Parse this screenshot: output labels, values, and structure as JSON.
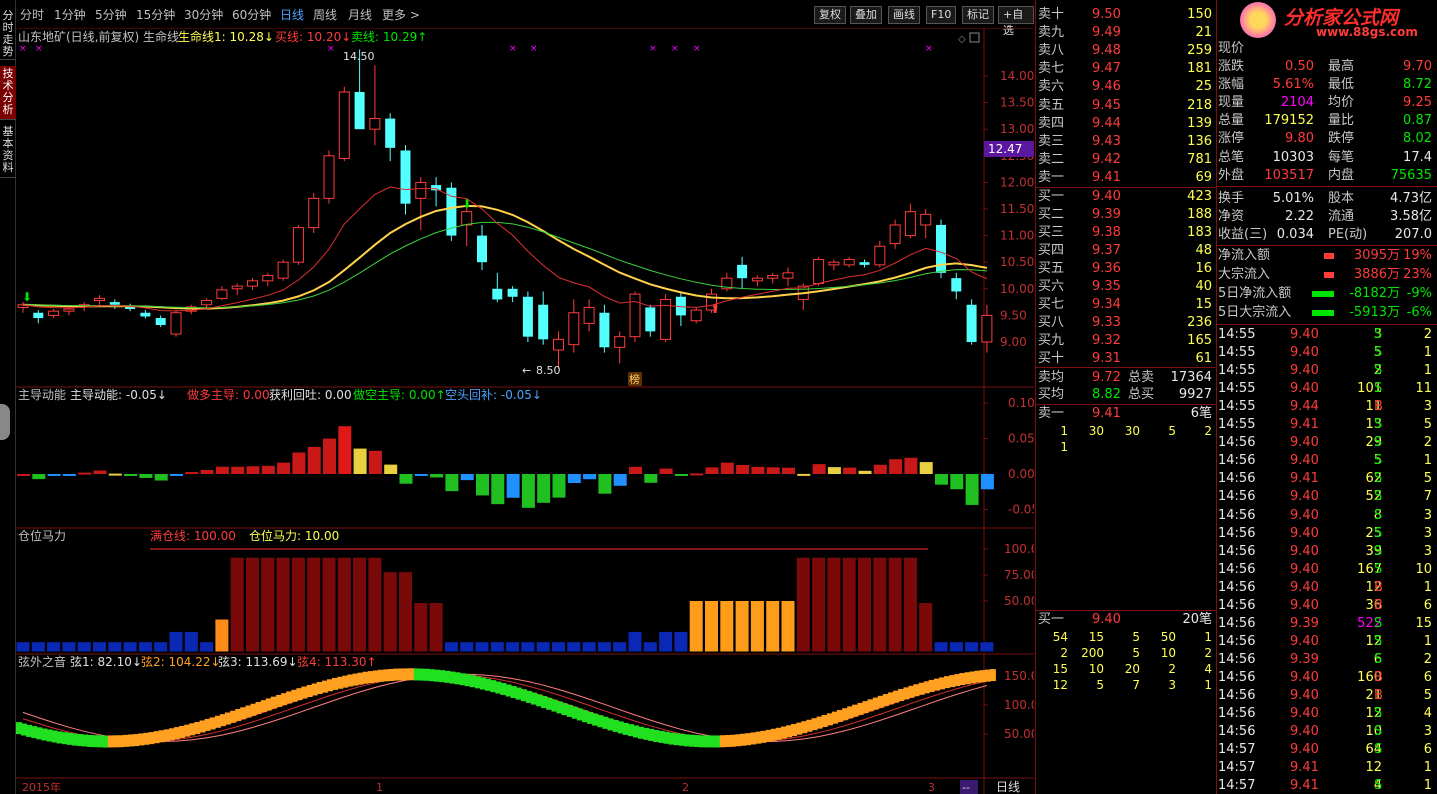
{
  "left_tabs": [
    "分时走势",
    "技术分析",
    "基本资料"
  ],
  "toolbar": {
    "periods": [
      "分时",
      "1分钟",
      "5分钟",
      "15分钟",
      "30分钟",
      "60分钟",
      "日线",
      "周线",
      "月线",
      "更多 >"
    ],
    "active": "日线",
    "buttons": [
      "复权",
      "叠加",
      "画线",
      "F10",
      "标记",
      "+自选"
    ]
  },
  "main_chart": {
    "title": "山东地矿(日线,前复权) 生命线",
    "ind1": "生命线1: 10.28↓",
    "ind2": "买线: 10.20↓",
    "ind3": "卖线: 10.29↑",
    "high_label": "14.50",
    "low_label": "8.50",
    "price_tag": "12.47",
    "bang": "榜",
    "y_ticks": [
      "14.00",
      "13.50",
      "13.00",
      "12.50",
      "12.00",
      "11.50",
      "11.00",
      "10.50",
      "10.00",
      "9.50",
      "9.00"
    ]
  },
  "ind_pane1": {
    "title": "主导动能",
    "v1": "主导动能: -0.05↓",
    "v2": "做多主导: 0.00",
    "v3": "获利回吐: 0.00",
    "v4": "做空主导: 0.00↑",
    "v5": "空头回补: -0.05↓",
    "y_ticks": [
      "0.10",
      "0.05",
      "0.00",
      "-0.05"
    ]
  },
  "ind_pane2": {
    "title": "仓位马力",
    "v1": "满仓线: 100.00",
    "v2": "仓位马力: 10.00",
    "y_ticks": [
      "100.0",
      "75.00",
      "50.00"
    ]
  },
  "ind_pane3": {
    "title": "弦外之音",
    "v1": "弦1: 82.10↓",
    "v2": "弦2: 104.22↓",
    "v3": "弦3: 113.69↓",
    "v4": "弦4: 113.30↑",
    "y_ticks": [
      "150.0",
      "100.0",
      "50.00"
    ]
  },
  "x_axis": {
    "labels": [
      "2015年",
      "1",
      "2",
      "3"
    ],
    "period": "日线",
    "dash": "--"
  },
  "sell_book": [
    {
      "label": "卖十",
      "price": "9.50",
      "vol": "150"
    },
    {
      "label": "卖九",
      "price": "9.49",
      "vol": "21"
    },
    {
      "label": "卖八",
      "price": "9.48",
      "vol": "259"
    },
    {
      "label": "卖七",
      "price": "9.47",
      "vol": "181"
    },
    {
      "label": "卖六",
      "price": "9.46",
      "vol": "25"
    },
    {
      "label": "卖五",
      "price": "9.45",
      "vol": "218"
    },
    {
      "label": "卖四",
      "price": "9.44",
      "vol": "139"
    },
    {
      "label": "卖三",
      "price": "9.43",
      "vol": "136"
    },
    {
      "label": "卖二",
      "price": "9.42",
      "vol": "781"
    },
    {
      "label": "卖一",
      "price": "9.41",
      "vol": "69"
    }
  ],
  "buy_book": [
    {
      "label": "买一",
      "price": "9.40",
      "vol": "423"
    },
    {
      "label": "买二",
      "price": "9.39",
      "vol": "188"
    },
    {
      "label": "买三",
      "price": "9.38",
      "vol": "183"
    },
    {
      "label": "买四",
      "price": "9.37",
      "vol": "48"
    },
    {
      "label": "买五",
      "price": "9.36",
      "vol": "16"
    },
    {
      "label": "买六",
      "price": "9.35",
      "vol": "40"
    },
    {
      "label": "买七",
      "price": "9.34",
      "vol": "15"
    },
    {
      "label": "买八",
      "price": "9.33",
      "vol": "236"
    },
    {
      "label": "买九",
      "price": "9.32",
      "vol": "165"
    },
    {
      "label": "买十",
      "price": "9.31",
      "vol": "61"
    }
  ],
  "avg": {
    "sell_avg_label": "卖均",
    "sell_avg": "9.72",
    "total_sell_label": "总卖",
    "total_sell": "17364",
    "buy_avg_label": "买均",
    "buy_avg": "8.82",
    "total_buy_label": "总买",
    "total_buy": "9927"
  },
  "queue1": {
    "label": "卖一",
    "price": "9.41",
    "count": "6笔",
    "rows": [
      [
        "1",
        "30",
        "30",
        "5",
        "2"
      ],
      [
        "1",
        "",
        "",
        "",
        ""
      ]
    ]
  },
  "queue2": {
    "label": "买一",
    "price": "9.40",
    "count": "20笔",
    "rows": [
      [
        "54",
        "15",
        "5",
        "50",
        "1"
      ],
      [
        "2",
        "200",
        "5",
        "10",
        "2"
      ],
      [
        "15",
        "10",
        "20",
        "2",
        "4"
      ],
      [
        "12",
        "5",
        "7",
        "3",
        "1"
      ]
    ]
  },
  "logo": {
    "text": "分析家公式网",
    "url": "www.88gs.com"
  },
  "quote_head": "现价",
  "quote": [
    {
      "l1": "涨跌",
      "v1": "0.50",
      "c1": "red",
      "l2": "最高",
      "v2": "9.70",
      "c2": "red"
    },
    {
      "l1": "涨幅",
      "v1": "5.61%",
      "c1": "red",
      "l2": "最低",
      "v2": "8.72",
      "c2": "grn"
    },
    {
      "l1": "现量",
      "v1": "2104",
      "c1": "mag",
      "l2": "均价",
      "v2": "9.25",
      "c2": "red"
    },
    {
      "l1": "总量",
      "v1": "179152",
      "c1": "yel",
      "l2": "量比",
      "v2": "0.87",
      "c2": "grn"
    },
    {
      "l1": "涨停",
      "v1": "9.80",
      "c1": "red",
      "l2": "跌停",
      "v2": "8.02",
      "c2": "grn"
    },
    {
      "l1": "总笔",
      "v1": "10303",
      "c1": "wht",
      "l2": "每笔",
      "v2": "17.4",
      "c2": "wht"
    },
    {
      "l1": "外盘",
      "v1": "103517",
      "c1": "red",
      "l2": "内盘",
      "v2": "75635",
      "c2": "grn"
    }
  ],
  "fin": [
    {
      "l1": "换手",
      "v1": "5.01%",
      "l2": "股本",
      "v2": "4.73亿"
    },
    {
      "l1": "净资",
      "v1": "2.22",
      "l2": "流通",
      "v2": "3.58亿"
    },
    {
      "l1": "收益(三)",
      "v1": "0.034",
      "l2": "PE(动)",
      "v2": "207.0"
    }
  ],
  "flow": [
    {
      "label": "净流入额",
      "value": "3095万",
      "pct": "19%",
      "color": "red"
    },
    {
      "label": "大宗流入",
      "value": "3886万",
      "pct": "23%",
      "color": "red"
    },
    {
      "label": "5日净流入额",
      "value": "-8182万",
      "pct": "-9%",
      "color": "grn"
    },
    {
      "label": "5日大宗流入",
      "value": "-5913万",
      "pct": "-6%",
      "color": "grn"
    }
  ],
  "ticks": [
    [
      "14:55",
      "9.40",
      "3",
      "S",
      "2"
    ],
    [
      "14:55",
      "9.40",
      "5",
      "S",
      "1"
    ],
    [
      "14:55",
      "9.40",
      "2",
      "S",
      "1"
    ],
    [
      "14:55",
      "9.40",
      "101",
      "S",
      "11"
    ],
    [
      "14:55",
      "9.44",
      "11",
      "B",
      "3"
    ],
    [
      "14:55",
      "9.41",
      "13",
      "S",
      "5"
    ],
    [
      "14:56",
      "9.40",
      "29",
      "S",
      "2"
    ],
    [
      "14:56",
      "9.40",
      "5",
      "S",
      "1"
    ],
    [
      "14:56",
      "9.41",
      "62",
      "S",
      "5"
    ],
    [
      "14:56",
      "9.40",
      "52",
      "S",
      "7"
    ],
    [
      "14:56",
      "9.40",
      "8",
      "S",
      "3"
    ],
    [
      "14:56",
      "9.40",
      "25",
      "S",
      "3"
    ],
    [
      "14:56",
      "9.40",
      "39",
      "S",
      "3"
    ],
    [
      "14:56",
      "9.40",
      "167",
      "S",
      "10"
    ],
    [
      "14:56",
      "9.40",
      "12",
      "B",
      "1"
    ],
    [
      "14:56",
      "9.40",
      "36",
      "B",
      "6"
    ],
    [
      "14:56",
      "9.39",
      "522",
      "S",
      "15"
    ],
    [
      "14:56",
      "9.40",
      "12",
      "S",
      "1"
    ],
    [
      "14:56",
      "9.39",
      "6",
      "S",
      "2"
    ],
    [
      "14:56",
      "9.40",
      "160",
      "B",
      "6"
    ],
    [
      "14:56",
      "9.40",
      "21",
      "B",
      "5"
    ],
    [
      "14:56",
      "9.40",
      "12",
      "S",
      "4"
    ],
    [
      "14:56",
      "9.40",
      "10",
      "S",
      "3"
    ],
    [
      "14:57",
      "9.40",
      "64",
      "S",
      "6"
    ],
    [
      "14:57",
      "9.41",
      "12",
      "",
      "1"
    ],
    [
      "14:57",
      "9.41",
      "4",
      "S",
      "1"
    ]
  ],
  "colors": {
    "up": "#ff3c3c",
    "down": "#54ffff",
    "bg": "#000000",
    "grid": "#7a1010"
  },
  "chart_data": {
    "type": "candlestick",
    "ylim": [
      8.5,
      14.5
    ],
    "candles": [
      [
        9.65,
        9.75,
        9.55,
        9.7
      ],
      [
        9.55,
        9.6,
        9.35,
        9.45
      ],
      [
        9.5,
        9.62,
        9.45,
        9.58
      ],
      [
        9.58,
        9.65,
        9.5,
        9.62
      ],
      [
        9.66,
        9.75,
        9.58,
        9.7
      ],
      [
        9.78,
        9.88,
        9.7,
        9.82
      ],
      [
        9.75,
        9.8,
        9.62,
        9.7
      ],
      [
        9.66,
        9.72,
        9.58,
        9.62
      ],
      [
        9.55,
        9.6,
        9.44,
        9.48
      ],
      [
        9.45,
        9.5,
        9.28,
        9.32
      ],
      [
        9.15,
        9.6,
        9.1,
        9.55
      ],
      [
        9.58,
        9.7,
        9.52,
        9.66
      ],
      [
        9.7,
        9.82,
        9.62,
        9.78
      ],
      [
        9.82,
        10.05,
        9.78,
        9.98
      ],
      [
        10.0,
        10.1,
        9.88,
        10.05
      ],
      [
        10.05,
        10.2,
        9.98,
        10.15
      ],
      [
        10.15,
        10.3,
        10.05,
        10.25
      ],
      [
        10.2,
        10.55,
        10.15,
        10.5
      ],
      [
        10.5,
        11.2,
        10.45,
        11.15
      ],
      [
        11.15,
        11.8,
        11.05,
        11.7
      ],
      [
        11.7,
        12.6,
        11.6,
        12.5
      ],
      [
        12.45,
        13.8,
        12.4,
        13.7
      ],
      [
        13.7,
        14.5,
        13.5,
        13.0
      ],
      [
        13.0,
        14.2,
        12.7,
        13.2
      ],
      [
        13.2,
        13.3,
        12.4,
        12.65
      ],
      [
        12.6,
        12.7,
        11.4,
        11.6
      ],
      [
        11.7,
        12.1,
        11.1,
        12.0
      ],
      [
        11.95,
        12.1,
        11.55,
        11.85
      ],
      [
        11.9,
        12.0,
        10.9,
        11.0
      ],
      [
        11.2,
        11.6,
        10.8,
        11.45
      ],
      [
        11.0,
        11.2,
        10.35,
        10.5
      ],
      [
        10.0,
        10.3,
        9.75,
        9.8
      ],
      [
        10.0,
        10.05,
        9.75,
        9.85
      ],
      [
        9.85,
        9.95,
        9.0,
        9.1
      ],
      [
        9.7,
        9.95,
        8.95,
        9.05
      ],
      [
        8.85,
        9.2,
        8.5,
        9.05
      ],
      [
        8.95,
        9.8,
        8.8,
        9.55
      ],
      [
        9.35,
        9.8,
        9.2,
        9.65
      ],
      [
        9.55,
        9.7,
        8.8,
        8.9
      ],
      [
        8.9,
        9.2,
        8.6,
        9.1
      ],
      [
        9.1,
        9.95,
        9.0,
        9.9
      ],
      [
        9.65,
        9.7,
        9.1,
        9.2
      ],
      [
        9.05,
        9.9,
        9.0,
        9.8
      ],
      [
        9.85,
        9.95,
        9.3,
        9.5
      ],
      [
        9.4,
        9.65,
        9.35,
        9.6
      ],
      [
        9.6,
        10.0,
        9.55,
        9.9
      ],
      [
        10.0,
        10.3,
        9.95,
        10.2
      ],
      [
        10.45,
        10.6,
        10.0,
        10.2
      ],
      [
        10.15,
        10.25,
        10.05,
        10.2
      ],
      [
        10.2,
        10.3,
        10.1,
        10.25
      ],
      [
        10.2,
        10.4,
        10.05,
        10.3
      ],
      [
        9.8,
        10.1,
        9.6,
        10.05
      ],
      [
        10.1,
        10.6,
        10.05,
        10.55
      ],
      [
        10.45,
        10.55,
        10.35,
        10.5
      ],
      [
        10.45,
        10.6,
        10.4,
        10.55
      ],
      [
        10.5,
        10.55,
        10.4,
        10.45
      ],
      [
        10.45,
        10.9,
        10.4,
        10.8
      ],
      [
        10.85,
        11.3,
        10.75,
        11.2
      ],
      [
        11.0,
        11.6,
        10.95,
        11.45
      ],
      [
        11.2,
        11.5,
        10.95,
        11.4
      ],
      [
        11.2,
        11.3,
        10.2,
        10.3
      ],
      [
        10.2,
        10.3,
        9.8,
        9.95
      ],
      [
        9.7,
        9.8,
        8.95,
        9.0
      ],
      [
        9.0,
        9.7,
        8.8,
        9.5
      ]
    ]
  }
}
